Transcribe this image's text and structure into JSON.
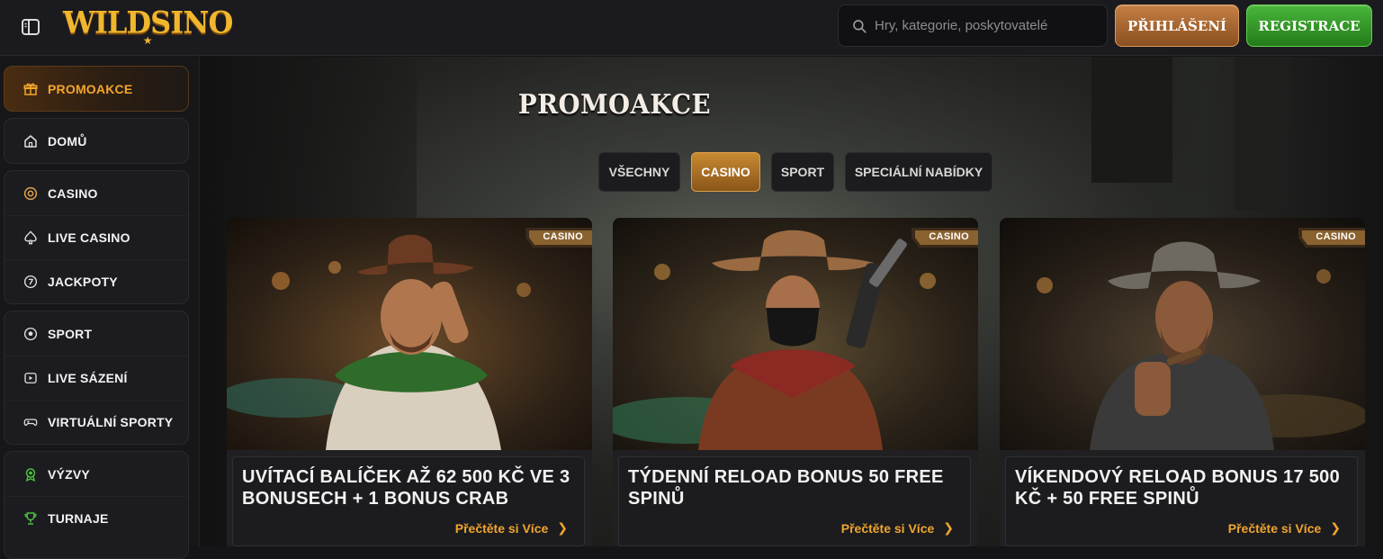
{
  "header": {
    "logo_text": "WILDSINO",
    "search_placeholder": "Hry, kategorie, poskytovatelé",
    "login_label": "PŘIHLÁŠENÍ",
    "register_label": "REGISTRACE"
  },
  "sidebar": {
    "groups": [
      {
        "items": [
          {
            "label": "PROMOAKCE",
            "icon": "gift-icon",
            "active": true
          }
        ]
      },
      {
        "items": [
          {
            "label": "DOMŮ",
            "icon": "home-icon"
          }
        ]
      },
      {
        "items": [
          {
            "label": "CASINO",
            "icon": "casino-chip-icon"
          },
          {
            "label": "LIVE CASINO",
            "icon": "spade-icon"
          },
          {
            "label": "JACKPOTY",
            "icon": "seven-icon"
          }
        ]
      },
      {
        "items": [
          {
            "label": "SPORT",
            "icon": "soccer-ball-icon"
          },
          {
            "label": "LIVE SÁZENÍ",
            "icon": "live-play-icon"
          },
          {
            "label": "VIRTUÁLNÍ SPORTY",
            "icon": "gamepad-icon"
          }
        ]
      },
      {
        "items": [
          {
            "label": "VÝZVY",
            "icon": "medal-icon"
          },
          {
            "label": "TURNAJE",
            "icon": "trophy-icon"
          }
        ]
      }
    ]
  },
  "main": {
    "title": "PROMOAKCE",
    "tabs": [
      {
        "label": "VŠECHNY",
        "active": false
      },
      {
        "label": "CASINO",
        "active": true
      },
      {
        "label": "SPORT",
        "active": false
      },
      {
        "label": "SPECIÁLNÍ NABÍDKY",
        "active": false
      }
    ],
    "cards": [
      {
        "badge": "CASINO",
        "title": "UVÍTACÍ BALÍČEK AŽ 62 500 KČ VE 3 BONUSECH + 1 BONUS CRAB",
        "more": "Přečtěte si Více",
        "scarf_color": "#2f6b2a",
        "hat_color": "#6a3a22"
      },
      {
        "badge": "CASINO",
        "title": "TÝDENNÍ RELOAD BONUS 50 FREE SPINŮ",
        "more": "Přečtěte si Více",
        "scarf_color": "#8a2a22",
        "hat_color": "#9a6a42"
      },
      {
        "badge": "CASINO",
        "title": "VÍKENDOVÝ RELOAD BONUS 17 500 KČ + 50 FREE SPINŮ",
        "more": "Přečtěte si Více",
        "scarf_color": "#3a3a3a",
        "hat_color": "#6e6a62"
      }
    ]
  },
  "colors": {
    "accent": "#f0a52f",
    "login_gradient": "#c57f43",
    "register_gradient": "#49b63b",
    "background": "#151518"
  }
}
